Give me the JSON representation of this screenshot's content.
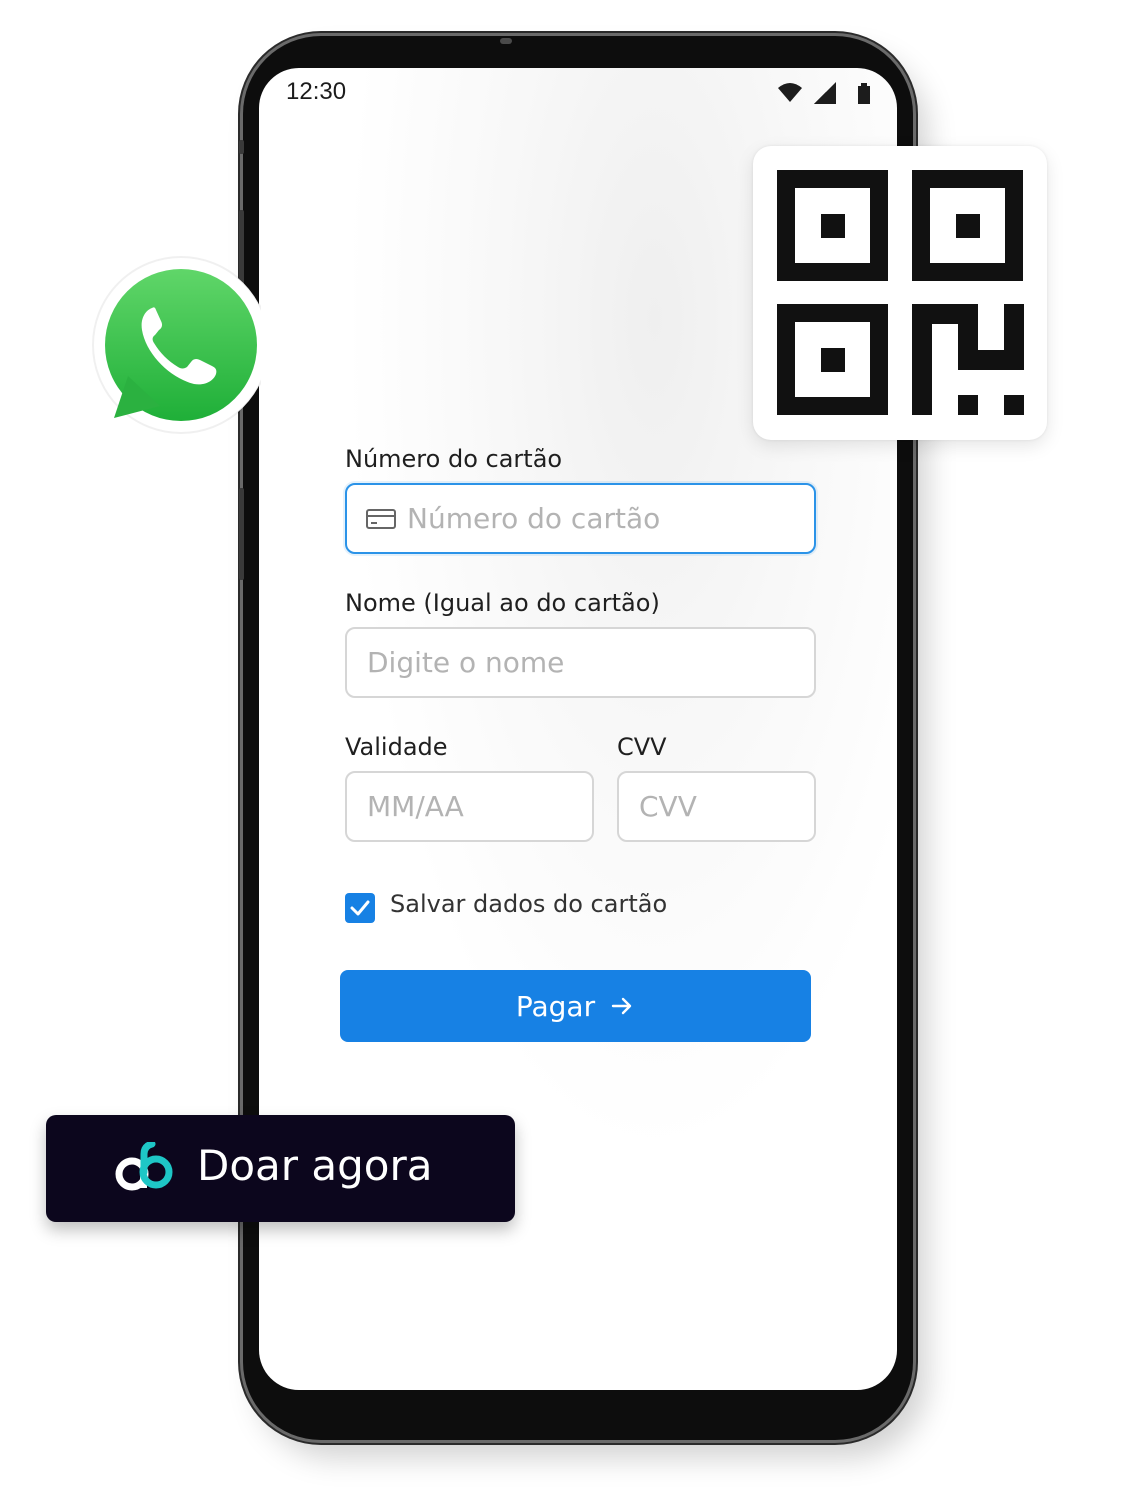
{
  "status_bar": {
    "time": "12:30",
    "icons": [
      "wifi-icon",
      "signal-icon",
      "battery-icon"
    ]
  },
  "form": {
    "card_number": {
      "label": "Número do cartão",
      "placeholder": "Número do cartão",
      "icon": "credit-card-icon"
    },
    "name": {
      "label": "Nome (Igual ao do cartão)",
      "placeholder": "Digite o nome"
    },
    "expiry": {
      "label": "Validade",
      "placeholder": "MM/AA"
    },
    "cvv": {
      "label": "CVV",
      "placeholder": "CVV"
    },
    "save_card": {
      "label": "Salvar dados do cartão",
      "checked": true
    },
    "pay_button": {
      "label": "Pagar",
      "icon": "arrow-right-icon"
    }
  },
  "badges": {
    "qr_icon": "qr-code-icon",
    "whatsapp_icon": "whatsapp-icon",
    "donate_button": {
      "label": "Doar agora",
      "logo": "brand-logo"
    }
  },
  "colors": {
    "accent": "#1781e4",
    "focus_border": "#2b93e8",
    "donate_bg": "#0c061d",
    "whatsapp_green": "#25d366",
    "logo_teal": "#1ec6c6"
  }
}
